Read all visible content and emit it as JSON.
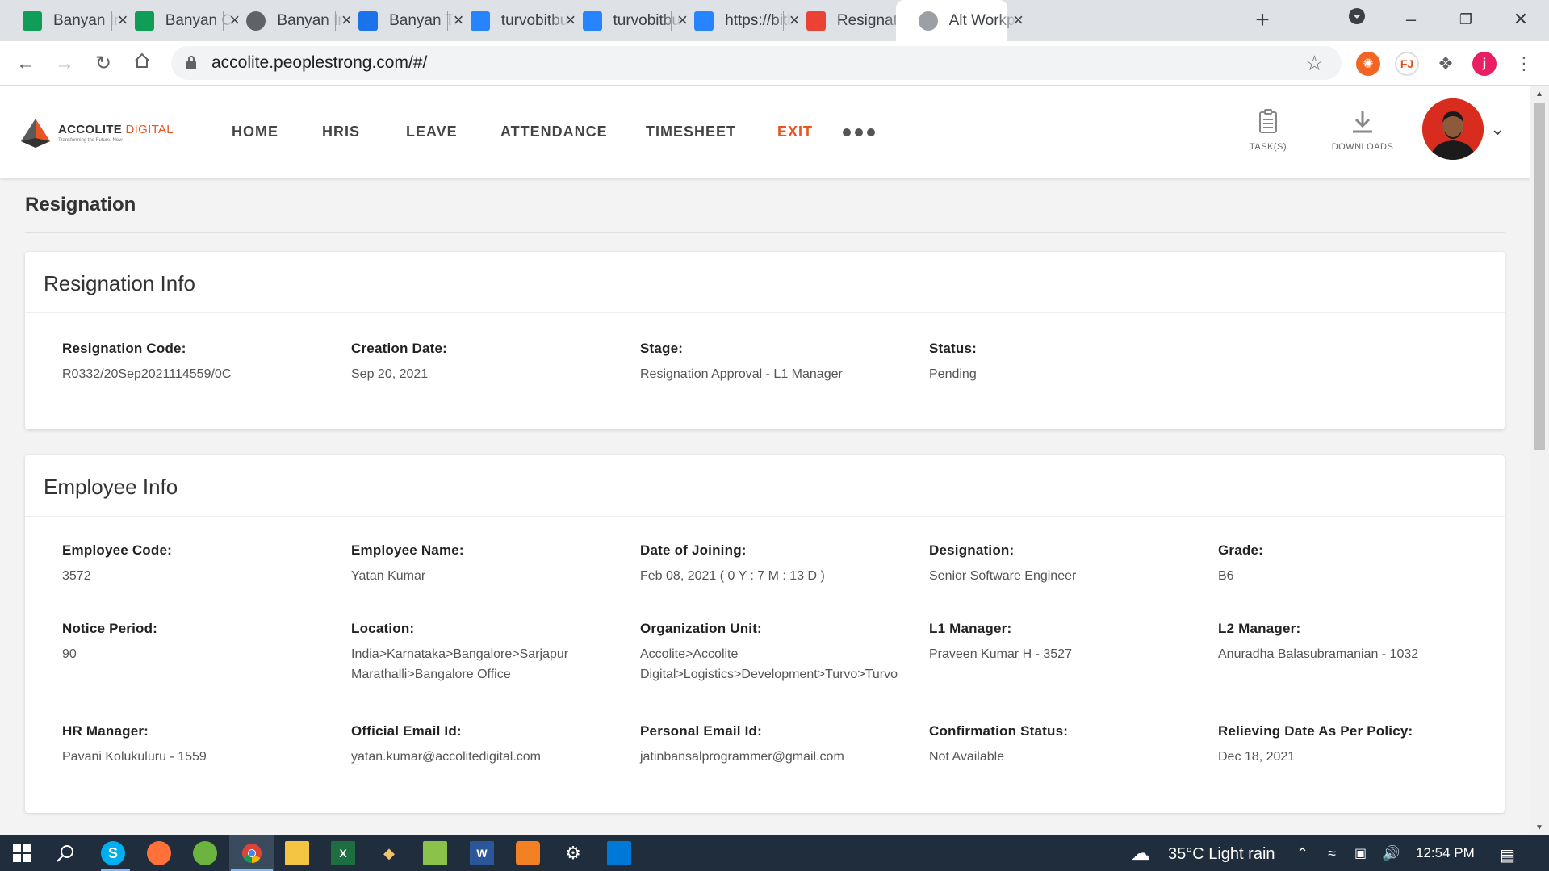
{
  "browser": {
    "tabs": [
      {
        "title": "Banyan Infrastructure",
        "icon": "sheets-icon",
        "color": "#0f9d58"
      },
      {
        "title": "Banyan Connect",
        "icon": "sheets-icon",
        "color": "#0f9d58"
      },
      {
        "title": "Banyan Infrastructure",
        "icon": "globe-icon",
        "color": "#5f6368"
      },
      {
        "title": "Banyan Tracker",
        "icon": "bank-icon",
        "color": "#1a73e8"
      },
      {
        "title": "turvobitbucket",
        "icon": "bitbucket-icon",
        "color": "#2684ff"
      },
      {
        "title": "turvobitbucket",
        "icon": "bitbucket-icon",
        "color": "#2684ff"
      },
      {
        "title": "https://bitbucket",
        "icon": "bitbucket-icon",
        "color": "#2684ff"
      },
      {
        "title": "Resignation",
        "icon": "gmail-icon",
        "color": "#ea4335"
      },
      {
        "title": "Alt Workplace",
        "icon": "app-icon",
        "color": "#9aa0a6"
      }
    ],
    "new_tab": "+",
    "url": "accolite.peoplestrong.com/#/",
    "profile_initial": "j"
  },
  "app": {
    "logo": {
      "brand_a": "ACCOLITE",
      "brand_b": "DIGITAL",
      "tagline": "Transforming the Future, Now"
    },
    "nav": [
      "HOME",
      "HRIS",
      "LEAVE",
      "ATTENDANCE",
      "TIMESHEET",
      "EXIT"
    ],
    "tasks_label": "TASK(S)",
    "downloads_label": "DOWNLOADS",
    "accent_color": "#e95420"
  },
  "page": {
    "title": "Resignation",
    "resignation_info": {
      "title": "Resignation Info",
      "fields": [
        {
          "label": "Resignation Code:",
          "value": "R0332/20Sep2021114559/0C"
        },
        {
          "label": "Creation Date:",
          "value": "Sep 20, 2021"
        },
        {
          "label": "Stage:",
          "value": "Resignation Approval - L1 Manager"
        },
        {
          "label": "Status:",
          "value": "Pending"
        }
      ]
    },
    "employee_info": {
      "title": "Employee Info",
      "fields": [
        {
          "label": "Employee Code:",
          "value": "3572"
        },
        {
          "label": "Employee Name:",
          "value": "Yatan Kumar"
        },
        {
          "label": "Date of Joining:",
          "value": "Feb 08, 2021 ( 0 Y : 7 M : 13 D )"
        },
        {
          "label": "Designation:",
          "value": "Senior Software Engineer"
        },
        {
          "label": "Grade:",
          "value": "B6"
        },
        {
          "label": "Notice Period:",
          "value": "90"
        },
        {
          "label": "Location:",
          "value": "India>Karnataka>Bangalore>Sarjapur Marathalli>Bangalore Office"
        },
        {
          "label": "Organization Unit:",
          "value": "Accolite>Accolite Digital>Logistics>Development>Turvo>Turvo"
        },
        {
          "label": "L1 Manager:",
          "value": "Praveen Kumar H - 3527"
        },
        {
          "label": "L2 Manager:",
          "value": "Anuradha Balasubramanian - 1032"
        },
        {
          "label": "HR Manager:",
          "value": "Pavani Kolukuluru - 1559"
        },
        {
          "label": "Official Email Id:",
          "value": "yatan.kumar@accolitedigital.com"
        },
        {
          "label": "Personal Email Id:",
          "value": "jatinbansalprogrammer@gmail.com"
        },
        {
          "label": "Confirmation Status:",
          "value": "Not Available"
        },
        {
          "label": "Relieving Date As Per Policy:",
          "value": "Dec 18, 2021"
        }
      ]
    }
  },
  "taskbar": {
    "weather": "35°C  Light rain",
    "time": "12:54 PM"
  }
}
